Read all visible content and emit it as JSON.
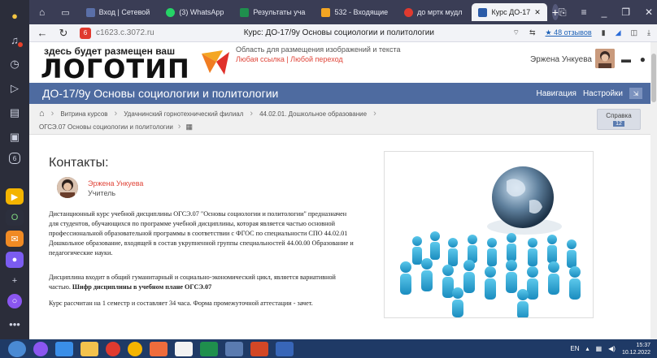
{
  "browser": {
    "tabs": [
      {
        "label": "Вход | Сетевой",
        "color": "#5a6fa8"
      },
      {
        "label": "(3) WhatsApp",
        "color": "#25d366"
      },
      {
        "label": "Результаты уча",
        "color": "#1f8f4d"
      },
      {
        "label": "532 - Входящие",
        "color": "#f4a623"
      },
      {
        "label": "до мртк мудл",
        "color": "#e03a2f"
      },
      {
        "label": "Курс ДО-17",
        "color": "#2b5ba8",
        "active": true
      }
    ],
    "new_tab": "+",
    "url": "c1623.c.3072.ru",
    "page_title": "Курс: ДО-17/9у Основы социологии и политологии",
    "reviews": "★ 48 отзывов"
  },
  "header": {
    "logo_small": "здесь будет размещен ваш",
    "logo_big": "ЛОГОТИП",
    "adv_area": "Область для размещения изображений и текста",
    "adv_links": "Любая ссылка  |  Любой переход",
    "user_name": "Эржена Ункуева"
  },
  "course": {
    "title": "ДО-17/9у Основы социологии и политологии",
    "nav_navigation": "Навигация",
    "nav_settings": "Настройки"
  },
  "breadcrumb": {
    "items_line1": [
      "Витрина курсов",
      "Удачнинский горнотехнический филиал",
      "44.02.01. Дошкольное образование"
    ],
    "item_line2": "ОГСЭ.07 Основы социологии и политологии",
    "help_label": "Справка",
    "help_count": "12"
  },
  "content": {
    "heading": "Контакты:",
    "teacher_name": "Эржена Ункуева",
    "teacher_role": "Учитель",
    "para1": "Дистанционный курс учебной дисциплины ОГСЭ.07 \"Основы социологии и политологии\" предназначен для студентов, обучающихся по программе учебной дисциплины, которая является частью основной профессиональной образовательной программы в соответствии с ФГОС по специальности СПО 44.02.01 Дошкольное образование, входящей в состав укрупненной группы специальностей 44.00.00 Образование и педагогические науки.",
    "para2_start": "Дисциплина входит в общий гуманитарный и социально-экономический цикл, является вариативной частью. ",
    "para2_bold": "Шифр дисциплины в учебном плане ОГСЭ.07",
    "para3": "Курс рассчитан на 1 семестр и составляет 34 часа.  Форма промежуточной аттестации - зачет."
  },
  "taskbar": {
    "lang": "EN",
    "time": "15:37",
    "date": "10.12.2022"
  }
}
